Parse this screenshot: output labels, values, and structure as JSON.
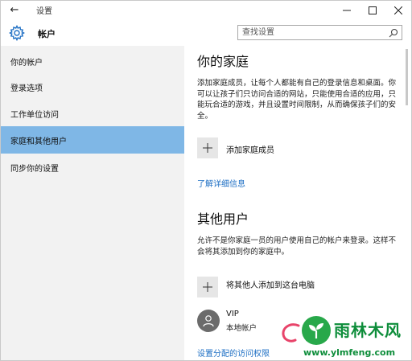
{
  "window": {
    "back_glyph": "←",
    "title": "设置",
    "controls": [
      "minimize-icon",
      "maximize-icon",
      "close-icon"
    ]
  },
  "header": {
    "icon": "gear-icon",
    "title": "帐户",
    "search_placeholder": "查找设置",
    "search_icon": "search-icon"
  },
  "sidebar": {
    "items": [
      {
        "label": "你的帐户"
      },
      {
        "label": "登录选项"
      },
      {
        "label": "工作单位访问"
      },
      {
        "label": "家庭和其他用户",
        "selected": true
      },
      {
        "label": "同步你的设置"
      }
    ]
  },
  "family": {
    "heading": "你的家庭",
    "description": "添加家庭成员，让每个人都能有自己的登录信息和桌面。你可以让孩子们只访问合适的网站，只能使用合适的应用，只能玩合适的游戏，并且设置时间限制，从而确保孩子们的安全。",
    "add_label": "添加家庭成员",
    "learn_more": "了解详细信息"
  },
  "others": {
    "heading": "其他用户",
    "description": "允许不是你家庭一员的用户使用自己的帐户来登录。这样不会将其添加到你的家庭中。",
    "add_label": "将其他人添加到这台电脑",
    "user": {
      "name": "VIP",
      "type": "本地帐户"
    },
    "assigned_access": "设置分配的访问权限"
  },
  "watermark": {
    "title": "雨林木风",
    "url": "www.ylmfeng.com"
  },
  "colors": {
    "selected_bg": "#7fb7e6",
    "sidebar_bg": "#f2f2f2",
    "link": "#1e6fc4",
    "watermark": "#0d8d3a"
  }
}
